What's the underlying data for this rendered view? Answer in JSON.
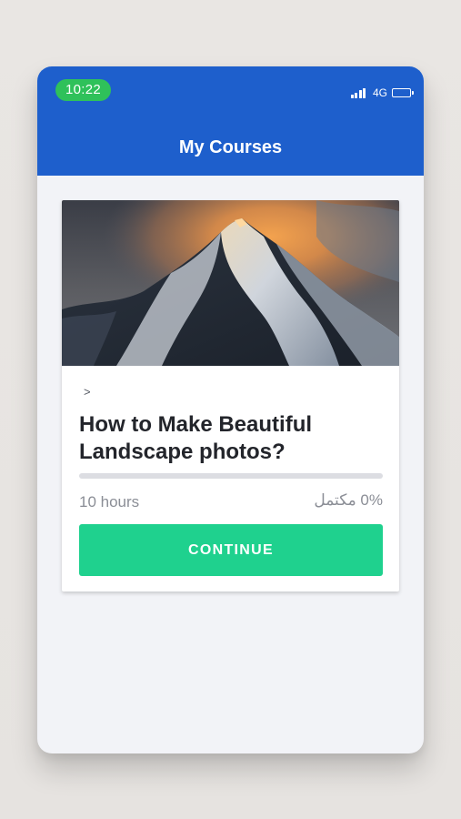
{
  "status_bar": {
    "time": "10:22",
    "network": "4G",
    "signal_icon": "signal-icon",
    "battery_icon": "battery-icon"
  },
  "header": {
    "title": "My Courses",
    "background_color": "#1e5fcc"
  },
  "course_card": {
    "image_icon": "mountain-landscape-photo",
    "chevron": ">",
    "title": "How to Make Beautiful Landscape photos?",
    "progress_percent": 0,
    "duration": "10 hours",
    "completion": "0% مكتمل",
    "button_label": "CONTINUE",
    "accent_color": "#1fd18e"
  }
}
